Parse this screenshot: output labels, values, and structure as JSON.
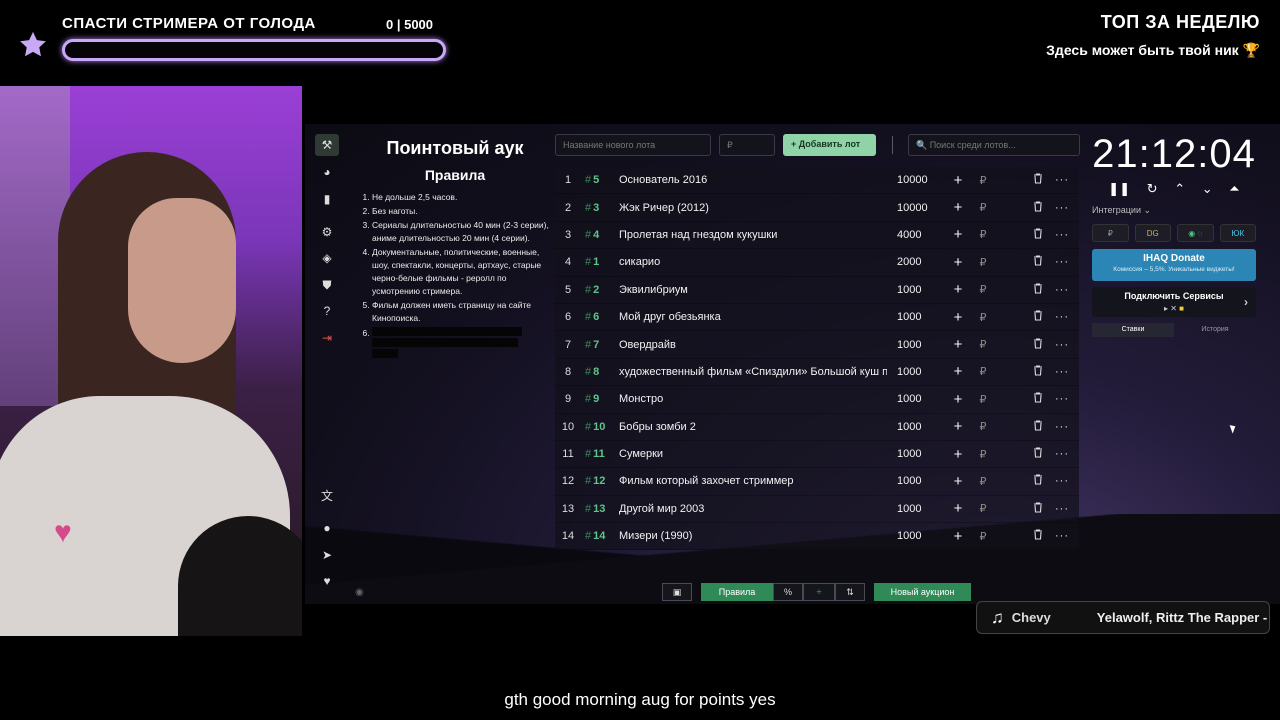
{
  "overlay": {
    "goal_title": "СПАСТИ СТРИМЕРА ОТ ГОЛОДА",
    "goal_count": "0 | 5000",
    "goal_progress": 0,
    "top_week_title": "ТОП ЗА НЕДЕЛЮ",
    "top_week_name": "Здесь может быть твой ник 🏆",
    "subtitle": "gth good morning aug for points yes",
    "accent": "#b184f0"
  },
  "rules": {
    "title": "Поинтовый аук",
    "subtitle": "Правила",
    "items": [
      "Не дольше 2,5 часов.",
      "Без наготы.",
      "Сериалы длительностью 40 мин (2-3 серии), аниме длительностью 20 мин (4 серии).",
      "Документальные, политические, военные, шоу, спектакли, концерты, артхаус, старые черно-белые фильмы - реролл по усмотрению стримера.",
      "Фильм должен иметь страницу на сайте Кинопоиска.",
      ""
    ]
  },
  "toolbar": {
    "new_lot_placeholder": "Название нового лота",
    "amount_placeholder": "₽",
    "add_lot": "+ Добавить лот",
    "search_placeholder": "🔍 Поиск среди лотов..."
  },
  "lots": [
    {
      "n": "1",
      "id": "5",
      "name": "Основатель 2016",
      "amount": "10000"
    },
    {
      "n": "2",
      "id": "3",
      "name": "Жэк Ричер (2012)",
      "amount": "10000"
    },
    {
      "n": "3",
      "id": "4",
      "name": "Пролетая над гнездом кукушки",
      "amount": "4000"
    },
    {
      "n": "4",
      "id": "1",
      "name": "сикарио",
      "amount": "2000"
    },
    {
      "n": "5",
      "id": "2",
      "name": "Эквилибриум",
      "amount": "1000"
    },
    {
      "n": "6",
      "id": "6",
      "name": "Мой друг обезьянка",
      "amount": "1000"
    },
    {
      "n": "7",
      "id": "7",
      "name": "Овердрайв",
      "amount": "1000"
    },
    {
      "n": "8",
      "id": "8",
      "name": "художественный фильм «Спиздили» Большой куш по",
      "amount": "1000"
    },
    {
      "n": "9",
      "id": "9",
      "name": "Монстро",
      "amount": "1000"
    },
    {
      "n": "10",
      "id": "10",
      "name": "Бобры зомби 2",
      "amount": "1000"
    },
    {
      "n": "11",
      "id": "11",
      "name": "Сумерки",
      "amount": "1000"
    },
    {
      "n": "12",
      "id": "12",
      "name": "Фильм который захочет стриммер",
      "amount": "1000"
    },
    {
      "n": "13",
      "id": "13",
      "name": "Другой мир 2003",
      "amount": "1000"
    },
    {
      "n": "14",
      "id": "14",
      "name": "Мизери (1990)",
      "amount": "1000"
    }
  ],
  "timer": {
    "time": "21:12:04",
    "integrations_label": "Интеграции ⌄",
    "chip1": "₽",
    "chip2": "DG",
    "chip3": "◉ ◌",
    "chip4": "ЮК",
    "donate_title": "IHAQ Donate",
    "donate_sub": "Комиссия – 5,5%. Уникальные виджеты!",
    "connect_label": "Подключить Сервисы",
    "tab_bids": "Ставки",
    "tab_history": "История"
  },
  "bottom": {
    "rules_btn": "Правила",
    "new_auction": "Новый аукцион"
  },
  "now_playing": {
    "song": "Chevy",
    "artist": "Yelawolf, Rittz The Rapper -"
  }
}
